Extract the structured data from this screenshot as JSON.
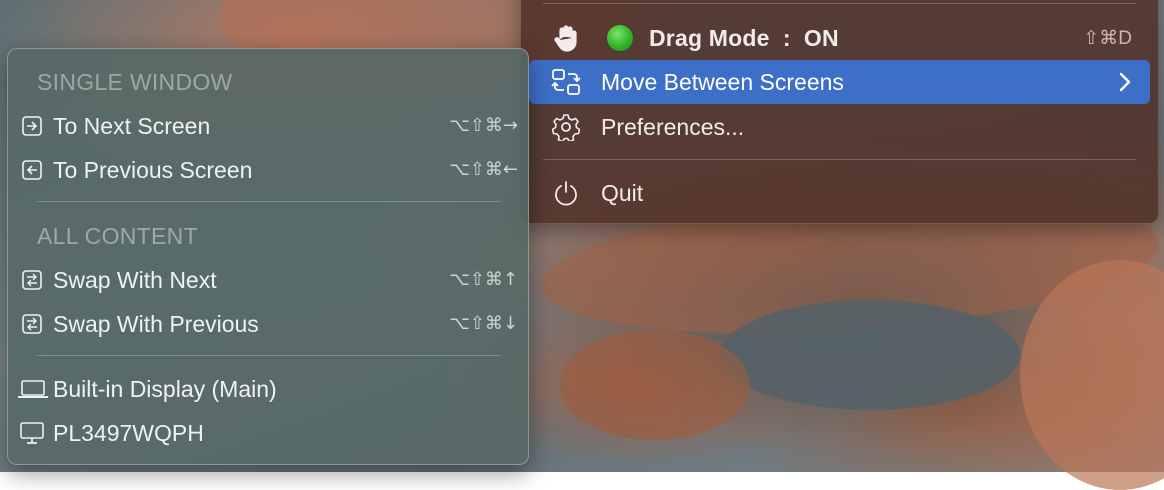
{
  "main_menu": {
    "drag_mode": {
      "label": "Drag Mode",
      "separator": ":",
      "state": "ON",
      "shortcut": "⇧⌘D",
      "status_color": "#2fb52a"
    },
    "move_between_screens": {
      "label": "Move Between Screens",
      "highlight_color": "#3e6fc8"
    },
    "preferences": {
      "label": "Preferences..."
    },
    "quit": {
      "label": "Quit"
    }
  },
  "sub_menu": {
    "single_window_header": "SINGLE WINDOW",
    "to_next_screen": {
      "label": "To Next Screen",
      "shortcut": "⌥⇧⌘→"
    },
    "to_previous_screen": {
      "label": "To Previous Screen",
      "shortcut": "⌥⇧⌘←"
    },
    "all_content_header": "ALL CONTENT",
    "swap_with_next": {
      "label": "Swap With Next",
      "shortcut": "⌥⇧⌘↑"
    },
    "swap_with_previous": {
      "label": "Swap With Previous",
      "shortcut": "⌥⇧⌘↓"
    },
    "displays": [
      {
        "label": "Built-in Display (Main)",
        "icon": "laptop-icon"
      },
      {
        "label": "PL3497WQPH",
        "icon": "monitor-icon"
      }
    ]
  }
}
